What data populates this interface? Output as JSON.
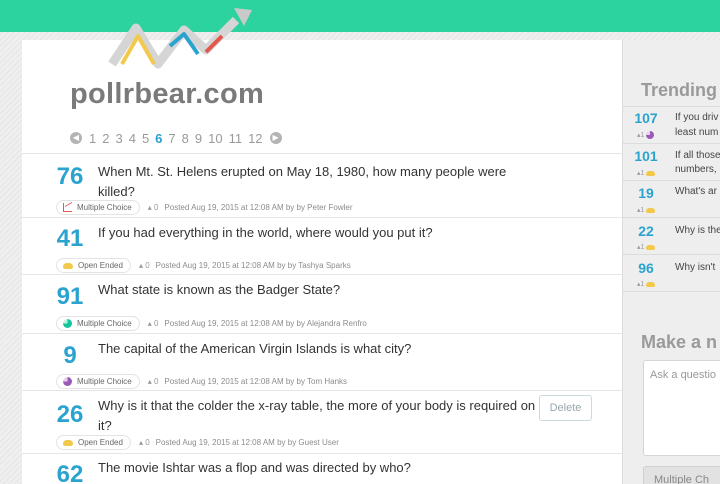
{
  "logo": {
    "text": "pollrbear.com"
  },
  "pagination": {
    "prev_icon": "chevron-left-circle-icon",
    "next_icon": "chevron-right-circle-icon",
    "pages": [
      "1",
      "2",
      "3",
      "4",
      "5",
      "6",
      "7",
      "8",
      "9",
      "10",
      "11",
      "12"
    ],
    "current": "6"
  },
  "questions": [
    {
      "score": "76",
      "text": "When Mt. St. Helens erupted on May 18, 1980, how many people were killed?",
      "type": "Multiple Choice",
      "icon": "line-chart-icon",
      "votes": "0",
      "posted": "Posted Aug 19, 2015 at 12:08 AM by by Peter Fowler"
    },
    {
      "score": "41",
      "text": "If you had everything in the world, where would you put it?",
      "type": "Open Ended",
      "icon": "cloud-icon",
      "votes": "0",
      "posted": "Posted Aug 19, 2015 at 12:08 AM by by Tashya Sparks"
    },
    {
      "score": "91",
      "text": "What state is known as the Badger State?",
      "type": "Multiple Choice",
      "icon": "pie-chart-icon",
      "votes": "0",
      "posted": "Posted Aug 19, 2015 at 12:08 AM by by Alejandra Renfro"
    },
    {
      "score": "9",
      "text": "The capital of the American Virgin Islands is what city?",
      "type": "Multiple Choice",
      "icon": "pie-chart-icon",
      "votes": "0",
      "posted": "Posted Aug 19, 2015 at 12:08 AM by by Tom Hanks"
    },
    {
      "score": "26",
      "text": "Why is it that the colder the x-ray table, the more of your body is required on it?",
      "type": "Open Ended",
      "icon": "cloud-icon",
      "votes": "0",
      "posted": "Posted Aug 19, 2015 at 12:08 AM by by Guest User",
      "delete_label": "Delete"
    },
    {
      "score": "62",
      "text": "The movie Ishtar was a flop and was directed by who?"
    }
  ],
  "trending": {
    "title": "Trending",
    "items": [
      {
        "score": "107",
        "text": "If you driv",
        "text2": "least num",
        "votes": "1",
        "icon": "pie-chart-icon"
      },
      {
        "score": "101",
        "text": "If all those",
        "text2": "numbers,",
        "votes": "1",
        "icon": "cloud-icon"
      },
      {
        "score": "19",
        "text": "What's ar",
        "votes": "1",
        "icon": "cloud-icon"
      },
      {
        "score": "22",
        "text": "Why is the",
        "votes": "1",
        "icon": "cloud-icon"
      },
      {
        "score": "96",
        "text": "Why isn't",
        "votes": "1",
        "icon": "cloud-icon"
      }
    ]
  },
  "make_new": {
    "title": "Make a n",
    "placeholder": "Ask a questio",
    "type_button": "Multiple Ch"
  },
  "colors": {
    "topbar": "#2dd39e",
    "score": "#2aa3cf",
    "active_page": "#2a9fd1"
  }
}
